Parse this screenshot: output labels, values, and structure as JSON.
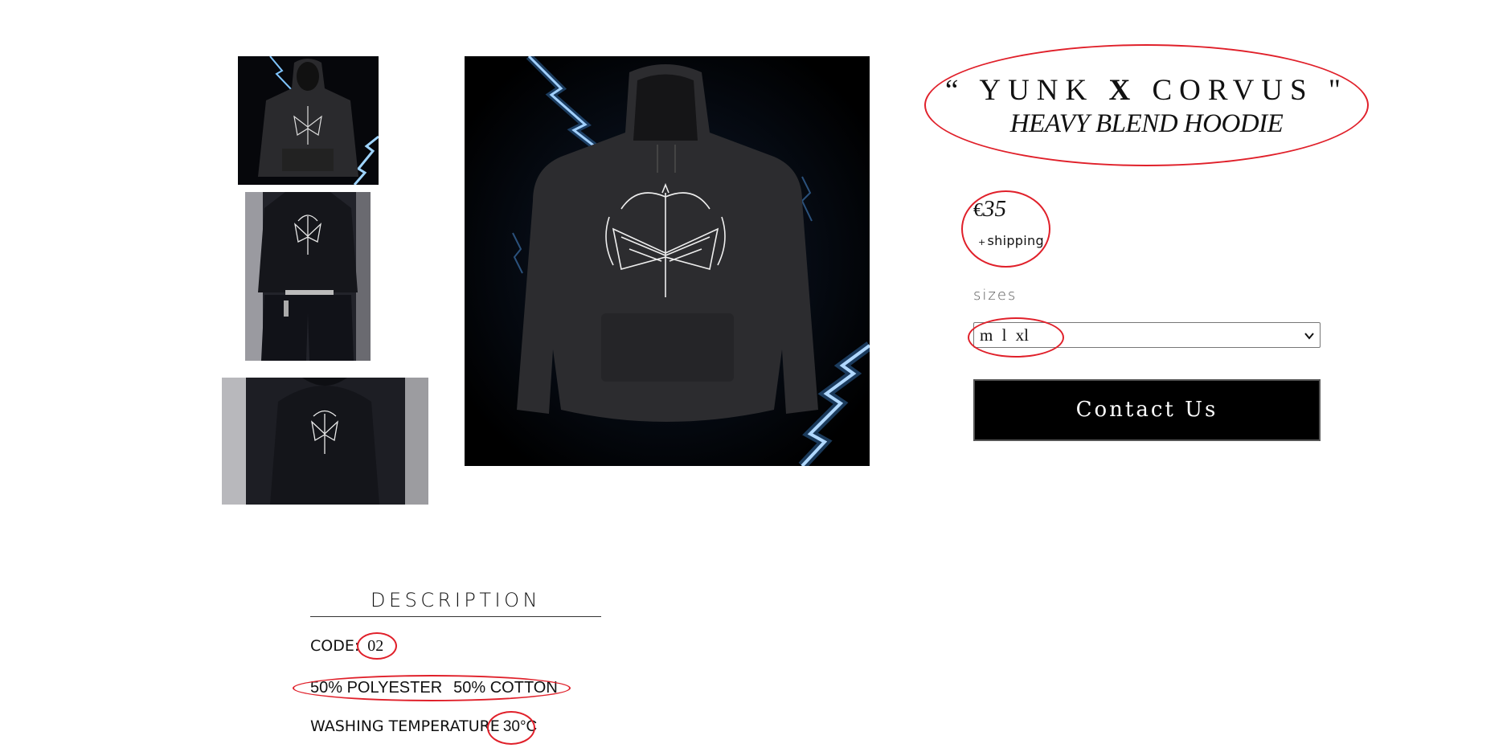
{
  "product": {
    "title_quote_open": "“",
    "title_brand_a": "YUNK",
    "title_x": "X",
    "title_brand_b": "CORVUS",
    "title_quote_close": "\"",
    "subtitle": "HEAVY BLEND HOODIE",
    "price_currency": "€",
    "price_amount": "35",
    "shipping_plus": "+",
    "shipping_label": "shipping",
    "sizes_label": "sizes",
    "size_select_value": "m  l  xl",
    "contact_button": "Contact Us"
  },
  "gallery": {
    "thumbnails": [
      {
        "name": "Hoodie front product shot"
      },
      {
        "name": "Hoodie worn, full front"
      },
      {
        "name": "Hoodie worn, close-up"
      }
    ]
  },
  "description": {
    "heading": "DESCRIPTION",
    "code_label": "CODE:",
    "code_value": "02",
    "composition_a": "50% POLYESTER",
    "composition_b": "50% COTTON",
    "washing_label": "WASHING TEMPERATURE",
    "washing_value": "30°C"
  },
  "colors": {
    "annotation": "#e0202a",
    "button_bg": "#000000",
    "button_text": "#ffffff",
    "lightning": "#7fc4ff"
  },
  "icons": {
    "select_arrow": "chevron-down-icon"
  }
}
